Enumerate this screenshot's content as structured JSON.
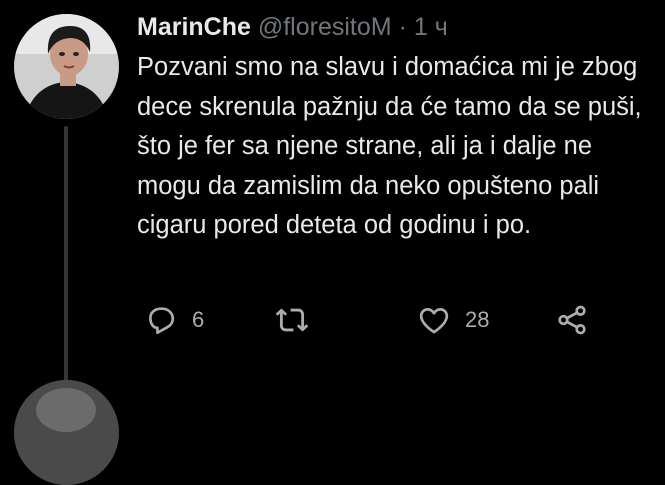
{
  "tweet": {
    "display_name": "MarinChe",
    "handle": "@floresitoM",
    "separator": "·",
    "time": "1 ч",
    "text": "Pozvani smo na slavu i domaćica mi je zbog dece skrenula pažnju da će tamo da se puši, što je fer sa njene strane, ali ja i dalje ne mogu da zamislim da neko opušteno pali cigaru pored deteta od godinu i po.",
    "reply_count": "6",
    "retweet_count": "",
    "like_count": "28"
  },
  "icons": {
    "reply": "reply-icon",
    "retweet": "retweet-icon",
    "like": "heart-icon",
    "share": "share-icon"
  },
  "colors": {
    "background": "#000000",
    "primary_text": "#e7e9ea",
    "secondary_text": "#71767b",
    "thread_line": "#333639"
  }
}
